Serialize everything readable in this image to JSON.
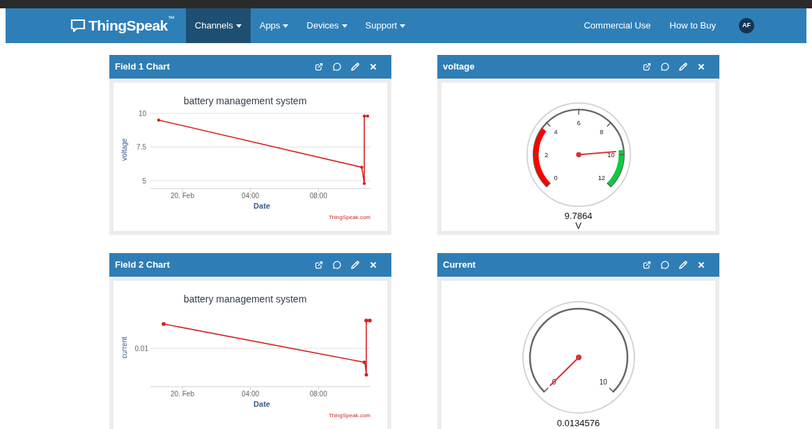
{
  "navbar": {
    "logo": "ThingSpeak",
    "trademark": "™",
    "menu": [
      {
        "label": "Channels",
        "selected": true
      },
      {
        "label": "Apps",
        "selected": false
      },
      {
        "label": "Devices",
        "selected": false
      },
      {
        "label": "Support",
        "selected": false
      }
    ],
    "right_links": [
      "Commercial Use",
      "How to Buy"
    ],
    "avatar": "AF"
  },
  "panels": [
    {
      "kind": "line_chart",
      "title": "Field 1 Chart",
      "credit": "ThingSpeak.com",
      "chart_data": {
        "type": "line",
        "title": "battery management system",
        "xlabel": "Date",
        "ylabel": "voltage",
        "x": [
          -1.4,
          10.55,
          10.7,
          10.7,
          10.9
        ],
        "series": [
          {
            "color": "#d62020",
            "values": [
              9.5,
              6.0,
              4.8,
              9.8,
              9.8
            ]
          }
        ],
        "xlim": [
          -1.89,
          11.07
        ],
        "ylim": [
          4.43,
          10
        ],
        "xticks": [
          {
            "value": 0,
            "label": "20. Feb"
          },
          {
            "value": 4,
            "label": "04:00"
          },
          {
            "value": 8,
            "label": "08:00"
          }
        ],
        "yticks": [
          5,
          {
            "value": 7.5,
            "label": "7.5"
          },
          10
        ]
      }
    },
    {
      "kind": "gauge",
      "title": "voltage",
      "scale_labels": [
        "0",
        "2",
        "4",
        "6",
        "8",
        "10",
        "12"
      ],
      "reading": "9.7864",
      "unit": "V"
    },
    {
      "kind": "trend_chart",
      "title": "Field 2 Chart",
      "chart_title": "battery management system",
      "ylabel": "current",
      "ytick_label": "0.01",
      "xlabel": "Date",
      "xtick_labels": [
        "20. Feb",
        "04:00",
        "08:00"
      ],
      "credit": "ThingSpeak.com"
    },
    {
      "kind": "gauge",
      "title": "Current",
      "scale_labels": [
        "0",
        "10"
      ],
      "reading": "0.0134576"
    }
  ]
}
